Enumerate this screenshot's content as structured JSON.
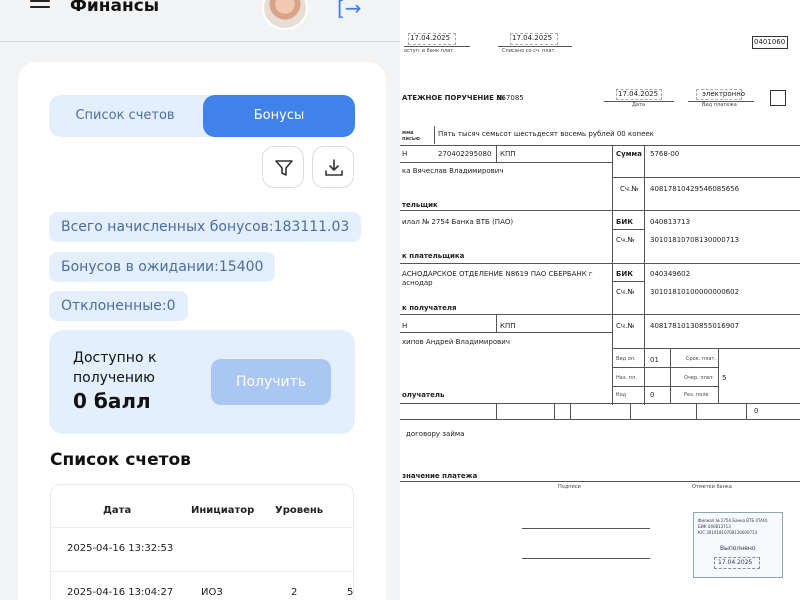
{
  "app": {
    "title": "Финансы",
    "tabs": [
      "Список счетов",
      "Бонусы"
    ],
    "active_tab": "Бонусы",
    "icons": {
      "menu": "hamburger-icon",
      "filter": "filter-icon",
      "download": "download-icon",
      "logout": "logout-icon"
    },
    "bonuses": {
      "total_label": "Всего начисленных бонусов:183111.03",
      "pending_label": "Бонусов в ожидании:15400",
      "rejected_label": "Отклоненные:0"
    },
    "available": {
      "label": "Доступно к получению",
      "value": "0 балл",
      "button": "Получить"
    },
    "accounts": {
      "title": "Список счетов",
      "columns": [
        "Дата",
        "Инициатор",
        "Уровень"
      ],
      "rows": [
        {
          "date": "2025-04-16 13:32:53",
          "initiator": "",
          "level": ""
        },
        {
          "date": "2025-04-16 13:04:27",
          "initiator": "ИОЗ",
          "level": "2",
          "extra": "5"
        }
      ]
    },
    "colors": {
      "accent": "#3e82ea",
      "chip_bg": "#e3effc",
      "chip_text": "#4b6d9f",
      "disabled_button": "#a9c7f2"
    }
  },
  "doc": {
    "date_received": "17.04.2025",
    "date_received_lbl": "оступ. в банк плат.",
    "date_debited": "17.04.2025",
    "date_debited_lbl": "Списано со сч. плат.",
    "form_code": "0401060",
    "title": "АТЕЖНОЕ ПОРУЧЕНИЕ №",
    "number": "867085",
    "date": "17.04.2025",
    "date_lbl": "Дата",
    "pay_type": "электронно",
    "pay_type_lbl": "Вид платежа",
    "sum_words_lbl": "мма писью",
    "sum_words": "Пять тысяч семьсот шестьдесят восемь рублей 00 копеек",
    "inn_lbl": "Н",
    "payer_inn": "270402295080",
    "kpp_lbl": "КПП",
    "sum_lbl": "Сумма",
    "sum": "5768-00",
    "payer_name": "ка Вячеслав Владимирович",
    "acc_lbl": "Сч.№",
    "payer_acc": "40817810429546085656",
    "payer_lbl": "тельщик",
    "payer_bank": "илал № 2754 Банка ВТБ (ПАО)",
    "bik_lbl": "БИК",
    "payer_bik": "040813713",
    "payer_corr": "30101810708130000713",
    "payer_bank_lbl": "к плательщика",
    "recipient_bank": "АСНОДАРСКОЕ ОТДЕЛЕНИЕ N8619 ПАО СБЕРБАНК г",
    "recipient_bank2": "аснодар",
    "recipient_bik": "040349602",
    "recipient_corr": "30101810100000000602",
    "recipient_bank_lbl": "к получателя",
    "recipient_acc": "40817810130855016907",
    "recipient_name": "хипов Андрей Владимирович",
    "op_type_lbl": "Вид оп.",
    "op_type": "01",
    "term_lbl": "Срок. плат.",
    "purpose_code_lbl": "Наз. пл.",
    "priority_lbl": "Очер. плат.",
    "priority": "5",
    "code_lbl": "Код",
    "code": "0",
    "reserve_lbl": "Рез. поле",
    "recipient_lbl": "олучатель",
    "tax_last": "0",
    "purpose": "договору займа",
    "purpose_lbl": "значение платежа",
    "sign_lbl": "Подписи",
    "bank_marks_lbl": "Отметки банка",
    "stamp_line1": "Филиал № 2754 Банка ВТБ (ПАО)",
    "stamp_line2": "БИК 040813713",
    "stamp_line3": "К/С 30101810708130000713",
    "stamp_status": "Выполнено",
    "stamp_date": "17.04.2025"
  }
}
